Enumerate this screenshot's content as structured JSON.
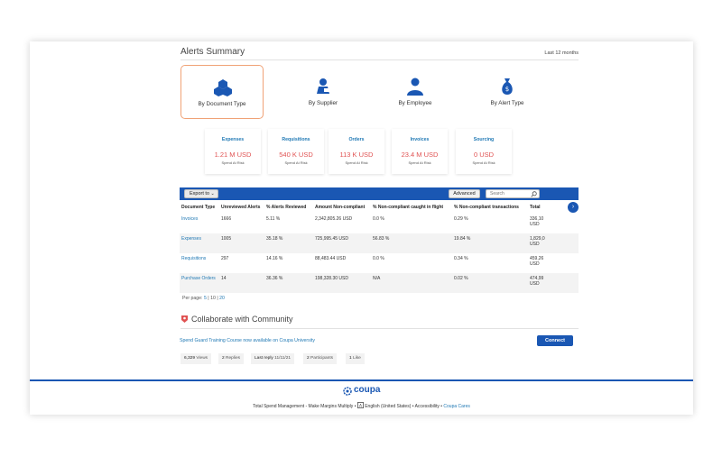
{
  "alerts": {
    "title": "Alerts Summary",
    "period": "Last 12 months",
    "categories": [
      {
        "label": "By Document Type",
        "icon": "documents-icon",
        "active": true
      },
      {
        "label": "By Supplier",
        "icon": "supplier-icon",
        "active": false
      },
      {
        "label": "By Employee",
        "icon": "employee-icon",
        "active": false
      },
      {
        "label": "By Alert Type",
        "icon": "money-bag-icon",
        "active": false
      }
    ],
    "tiles": [
      {
        "name": "Expenses",
        "value": "1.21 M USD",
        "sub": "Spend At Risk"
      },
      {
        "name": "Requisitions",
        "value": "540 K USD",
        "sub": "Spend At Risk"
      },
      {
        "name": "Orders",
        "value": "113 K USD",
        "sub": "Spend At Risk"
      },
      {
        "name": "Invoices",
        "value": "23.4 M USD",
        "sub": "Spend At Risk"
      },
      {
        "name": "Sourcing",
        "value": "0 USD",
        "sub": "Spend At Risk"
      }
    ]
  },
  "toolbar": {
    "export_label": "Export to",
    "advanced_label": "Advanced",
    "search_placeholder": "Search"
  },
  "table": {
    "columns": [
      "Document Type",
      "Unreviewed Alerts",
      "% Alerts Reviewed",
      "Amount Non-compliant",
      "% Non-compliant caught in flight",
      "% Non-compliant transactions",
      "Total"
    ],
    "rows": [
      [
        "Invoices",
        "1666",
        "5.11 %",
        "2,342,805.26 USD",
        "0.0 %",
        "0.29 %",
        "336,10",
        "USD"
      ],
      [
        "Expenses",
        "1005",
        "35.18 %",
        "725,995.45 USD",
        "56.83 %",
        "19.84 %",
        "1,829,0",
        "USD"
      ],
      [
        "Requisitions",
        "297",
        "14.16 %",
        "88,483.44 USD",
        "0.0 %",
        "0.34 %",
        "459,26",
        "USD"
      ],
      [
        "Purchase Orders",
        "14",
        "36.36 %",
        "198,328.30 USD",
        "N/A",
        "0.02 %",
        "474,99",
        "USD"
      ]
    ]
  },
  "pagination": {
    "label": "Per page:",
    "options": [
      "5",
      "10",
      "20"
    ]
  },
  "community": {
    "title": "Collaborate with Community",
    "link_text": "Spend Guard Training Course now available on Coupa University",
    "connect_label": "Connect",
    "stats": [
      {
        "value": "6,329",
        "label": "Views"
      },
      {
        "value": "2",
        "label": "Replies"
      },
      {
        "value": "Last reply",
        "label": "11/11/21"
      },
      {
        "value": "2",
        "label": "Participants"
      },
      {
        "value": "1",
        "label": "Like"
      }
    ]
  },
  "footer": {
    "logo_text": "coupa",
    "tagline": "Total Spend Management - Make Margins Multiply",
    "language": "English (United States)",
    "accessibility": "Accessibility",
    "cares": "Coupa Cares"
  },
  "colors": {
    "brand_blue": "#1a57b3",
    "alert_red": "#e05252",
    "active_border": "#f0a276"
  }
}
